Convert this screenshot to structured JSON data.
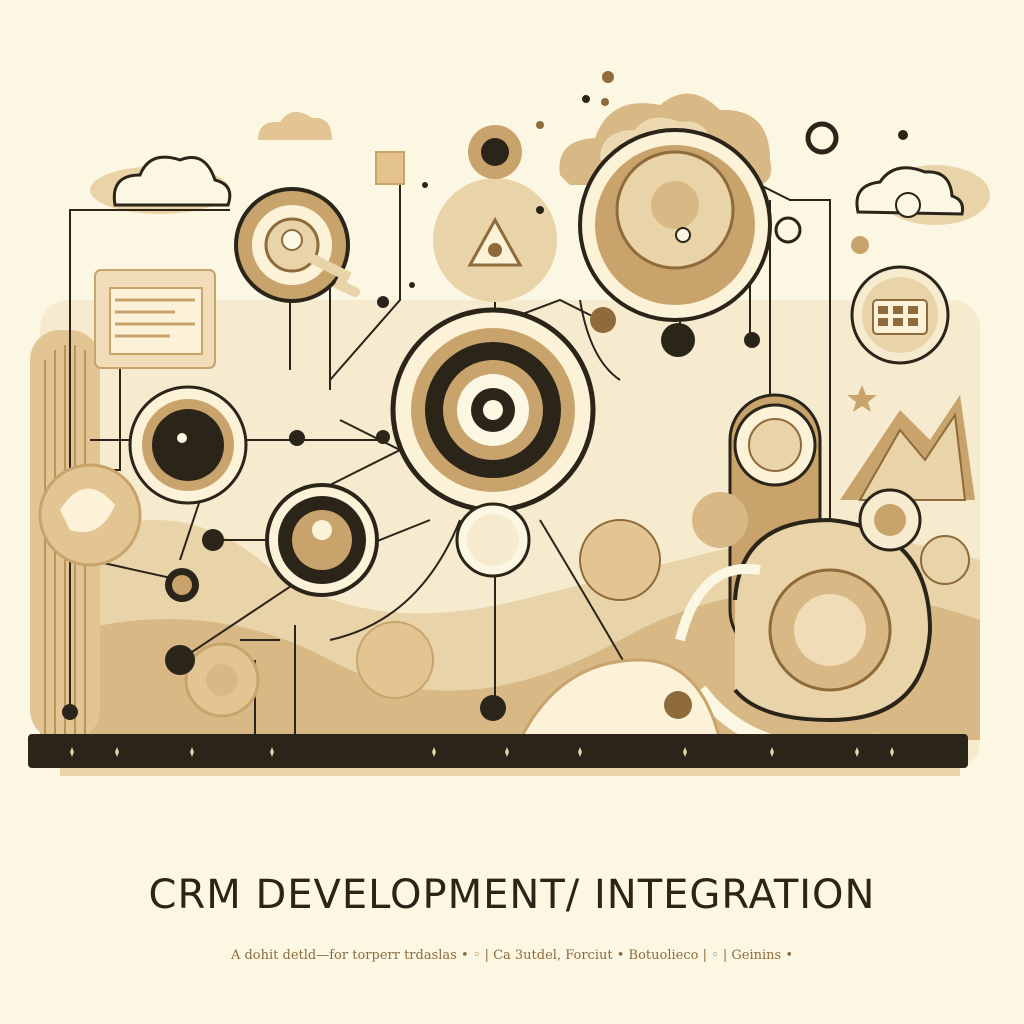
{
  "poster": {
    "title": "CRM DEVELOPMENT/ INTEGRATION",
    "subtitle": "A dohit detld—for torperr trdaslas • ◦ | Ca 3utdel, Forciut • Botuolieco | ◦ | Geinins •"
  },
  "palette": {
    "background": "#fcf7e3",
    "tan_light": "#e9d3a8",
    "tan_mid": "#c9a36c",
    "brown": "#8f6a3a",
    "ink": "#2a2419"
  },
  "icons": [
    "cloud-icon",
    "calendar-icon",
    "document-icon",
    "coin-icon",
    "target-icon",
    "star-icon",
    "mountain-icon"
  ]
}
